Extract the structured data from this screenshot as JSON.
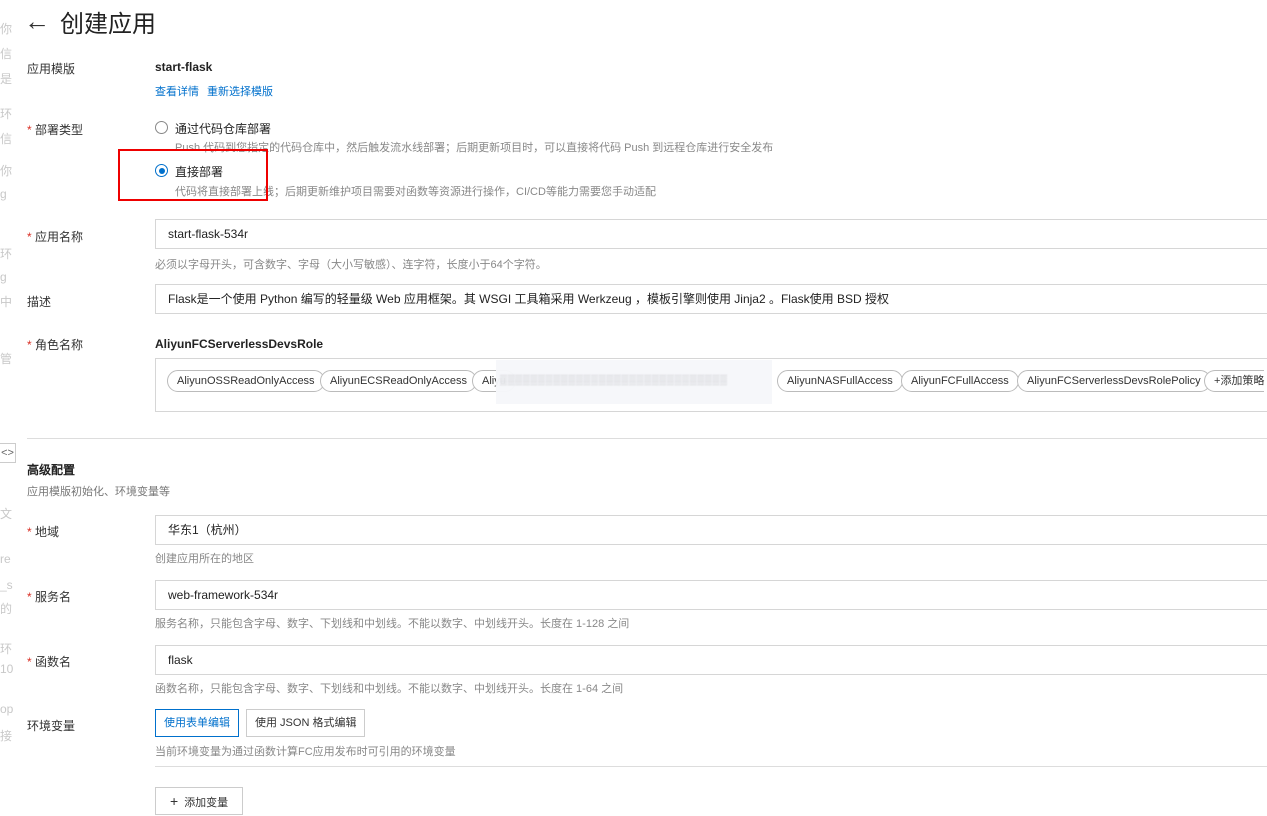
{
  "header": {
    "title": "创建应用"
  },
  "left_edge_fragments": [
    "你",
    "信",
    "是",
    "环",
    "信",
    "你",
    "g",
    "环",
    "g",
    "中",
    "管",
    "文",
    "re",
    "_s",
    "的",
    "环",
    "10",
    "op",
    "接"
  ],
  "template": {
    "label": "应用模版",
    "value": "start-flask",
    "links": [
      "查看详情",
      "重新选择模版"
    ]
  },
  "deploy_type": {
    "label": "部署类型",
    "options": [
      {
        "label": "通过代码仓库部署",
        "hint": "Push 代码到您指定的代码仓库中，然后触发流水线部署；后期更新项目时，可以直接将代码 Push 到远程仓库进行安全发布",
        "selected": false
      },
      {
        "label": "直接部署",
        "hint": "代码将直接部署上线；后期更新维护项目需要对函数等资源进行操作，CI/CD等能力需要您手动适配",
        "selected": true
      }
    ]
  },
  "app_name": {
    "label": "应用名称",
    "value": "start-flask-534r",
    "hint": "必须以字母开头，可含数字、字母（大小写敏感）、连字符，长度小于64个字符。"
  },
  "description": {
    "label": "描述",
    "value": "Flask是一个使用 Python 编写的轻量级 Web 应用框架。其 WSGI 工具箱采用 Werkzeug ，模板引擎则使用 Jinja2 。Flask使用 BSD 授权"
  },
  "role": {
    "label": "角色名称",
    "value": "AliyunFCServerlessDevsRole",
    "policies": [
      "AliyunOSSReadOnlyAccess",
      "AliyunECSReadOnlyAccess",
      "Aliyu",
      "AliyunNASFullAccess",
      "AliyunFCFullAccess",
      "AliyunFCServerlessDevsRolePolicy"
    ],
    "add_policy": "添加策略"
  },
  "advanced": {
    "title": "高级配置",
    "subtitle": "应用模版初始化、环境变量等"
  },
  "region": {
    "label": "地域",
    "value": "华东1（杭州）",
    "hint": "创建应用所在的地区"
  },
  "service": {
    "label": "服务名",
    "value": "web-framework-534r",
    "hint": "服务名称，只能包含字母、数字、下划线和中划线。不能以数字、中划线开头。长度在 1-128 之间"
  },
  "function": {
    "label": "函数名",
    "value": "flask",
    "hint": "函数名称，只能包含字母、数字、下划线和中划线。不能以数字、中划线开头。长度在 1-64 之间"
  },
  "env": {
    "label": "环境变量",
    "buttons": [
      "使用表单编辑",
      "使用 JSON 格式编辑"
    ],
    "hint": "当前环境变量为通过函数计算FC应用发布时可引用的环境变量",
    "add_label": "添加变量"
  }
}
